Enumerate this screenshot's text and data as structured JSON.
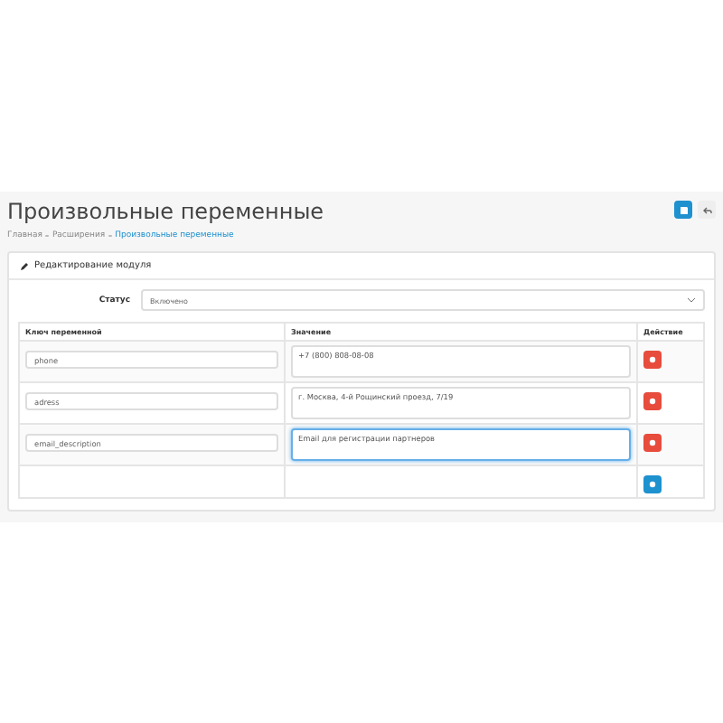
{
  "header": {
    "title": "Произвольные переменные",
    "breadcrumb": [
      {
        "label": "Главная",
        "selected": false
      },
      {
        "label": "Расширения",
        "selected": false
      },
      {
        "label": "Произвольные переменные",
        "selected": true
      }
    ]
  },
  "panel": {
    "title": "Редактирование модуля",
    "status": {
      "label": "Статус",
      "value": "Включено"
    },
    "columns": [
      "Ключ переменной",
      "Значение",
      "Действие"
    ],
    "rows": [
      {
        "key": "phone",
        "value": "+7 (800) 808-08-08",
        "focused": false
      },
      {
        "key": "adress",
        "value": "г. Москва, 4-й Рощинский проезд, 7/19",
        "focused": false
      },
      {
        "key": "email_description",
        "value": "Email для регистрации партнеров",
        "focused": true
      }
    ]
  }
}
